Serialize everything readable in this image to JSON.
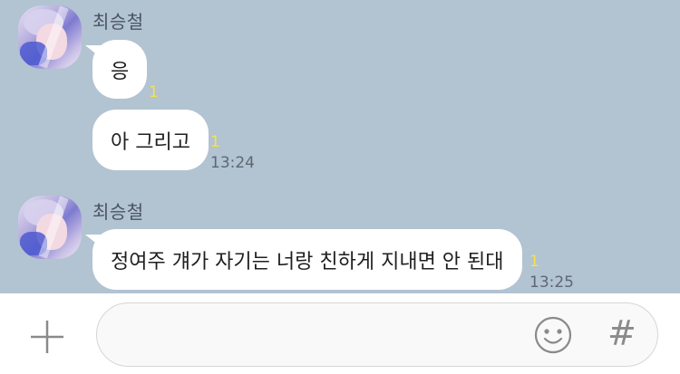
{
  "messages": [
    {
      "sender": "최승철",
      "bubbles": [
        {
          "text": "응",
          "unread": "1",
          "time": ""
        },
        {
          "text": "아 그리고",
          "unread": "1",
          "time": "13:24"
        }
      ]
    },
    {
      "sender": "최승철",
      "bubbles": [
        {
          "text": "정여주 걔가 자기는 너랑 친하게 지내면 안 된대",
          "unread": "1",
          "time": "13:25"
        }
      ]
    }
  ],
  "input": {
    "value": "",
    "placeholder": ""
  },
  "icons": {
    "attach": "plus-icon",
    "emoji": "emoji-icon",
    "hashtag": "hash-icon",
    "hashtag_glyph": "#"
  },
  "colors": {
    "chat_background": "#b2c3d2",
    "bubble": "#ffffff",
    "unread_count": "#f5e14c",
    "input_bar": "#ffffff"
  }
}
